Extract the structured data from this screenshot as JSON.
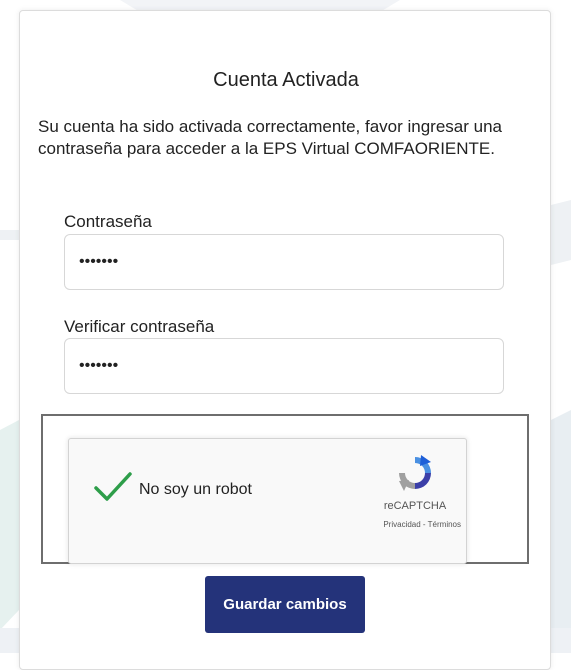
{
  "card": {
    "title": "Cuenta Activada",
    "intro": "Su cuenta ha sido activada correctamente, favor ingresar una contraseña para acceder a la EPS Virtual COMFAORIENTE."
  },
  "form": {
    "password_label": "Contraseña",
    "password_value": "•••••••",
    "verify_label": "Verificar contraseña",
    "verify_value": "•••••••"
  },
  "recaptcha": {
    "checked": true,
    "label": "No soy un robot",
    "brand": "reCAPTCHA",
    "links": "Privacidad - Términos",
    "check_color": "#2e9e4a"
  },
  "actions": {
    "save_label": "Guardar cambios",
    "save_color": "#24337a"
  }
}
